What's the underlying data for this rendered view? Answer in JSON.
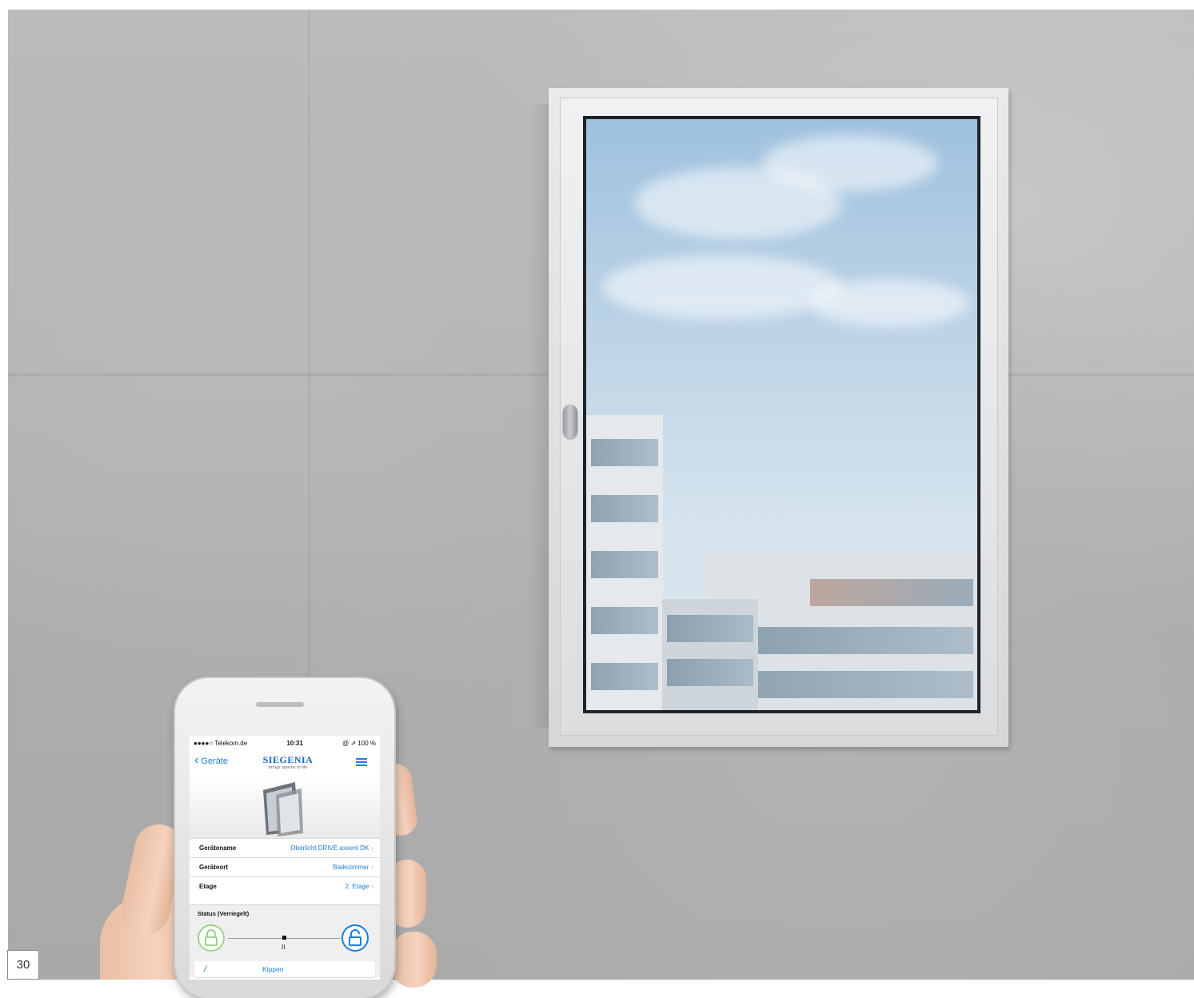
{
  "page": {
    "number": "30"
  },
  "phone": {
    "status_bar": {
      "carrier": "●●●●○ Telekom.de",
      "time": "10:31",
      "battery": "@ ⇗ 100 %"
    },
    "nav": {
      "back_label": "Geräte",
      "brand_name": "SIEGENIA",
      "brand_tagline": "brings spaces to life"
    },
    "device_rows": [
      {
        "label": "Gerätename",
        "value": "Oberlicht DRIVE axxent DK"
      },
      {
        "label": "Geräteort",
        "value": "Badezimmer"
      },
      {
        "label": "Etage",
        "value": "2. Etage"
      }
    ],
    "status": {
      "title": "Status (Verriegelt)",
      "position_label": "II",
      "locked_color": "#9bd58a",
      "unlocked_color": "#1a7ee0"
    },
    "action": {
      "label": "Kippen"
    },
    "colors": {
      "accent": "#1a7ee0"
    }
  }
}
